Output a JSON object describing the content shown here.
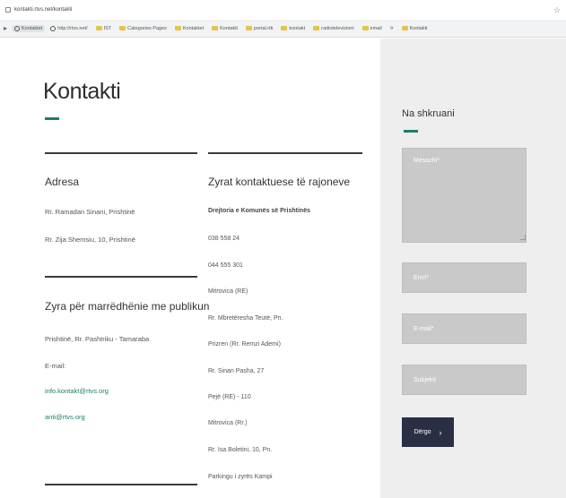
{
  "browser": {
    "url": "kontakti.rtvs.net/kontakti",
    "bookmarks": [
      "Kontaktet",
      "http://rtvs.net/",
      "IST",
      "Categories Pages",
      "Kontaktet",
      "Kontakti",
      "portal.rtk",
      "kontakt",
      "radiotelevizioni",
      "email",
      "Kontakti"
    ]
  },
  "main": {
    "title": "Kontakti",
    "address": {
      "heading": "Adresa",
      "lines": [
        "Rr. Ramadan Sinani, Prishtinë",
        "Rr. Zija Shemsiu, 10, Prishtinë"
      ]
    },
    "public_office": {
      "heading": "Zyra për marrëdhënie me publikun",
      "lines": [
        "Prishtinë, Rr. Pashtriku - Tamaraba",
        "E-mail:"
      ],
      "emails": [
        "info.kontakt@rtvs.org",
        "anti@rtvs.org"
      ]
    },
    "regional": {
      "heading": "Zyrat kontaktuese të rajoneve",
      "lines": [
        "Drejtoria e Komunës së Prishtinës",
        "038 558 24",
        "044 555 301",
        "Mitrovica (RE)",
        "Rr. Mbretëresha Teutë, Pn.",
        "Prizren (Rr. Remzi Ademi)",
        "Rr. Sinan Pasha, 27",
        "Pejë (RE) - 110",
        "Mitrovica (Rr.)",
        "Rr. Isa Boletini, 10, Pn.",
        "Parkingu i zyrës Kampi"
      ]
    }
  },
  "sidebar": {
    "title": "Na shkruani",
    "message_placeholder": "Mesazhi*",
    "name_placeholder": "Emri*",
    "email_placeholder": "E-mail*",
    "subject_placeholder": "Subjekti",
    "send_label": "Dërgo",
    "send_arrow": "›"
  },
  "colors": {
    "accent": "#1b7f6b",
    "sidebar_bg": "#eeeeee",
    "field_bg": "#c9c9c9",
    "button_bg": "#2b2f44"
  }
}
